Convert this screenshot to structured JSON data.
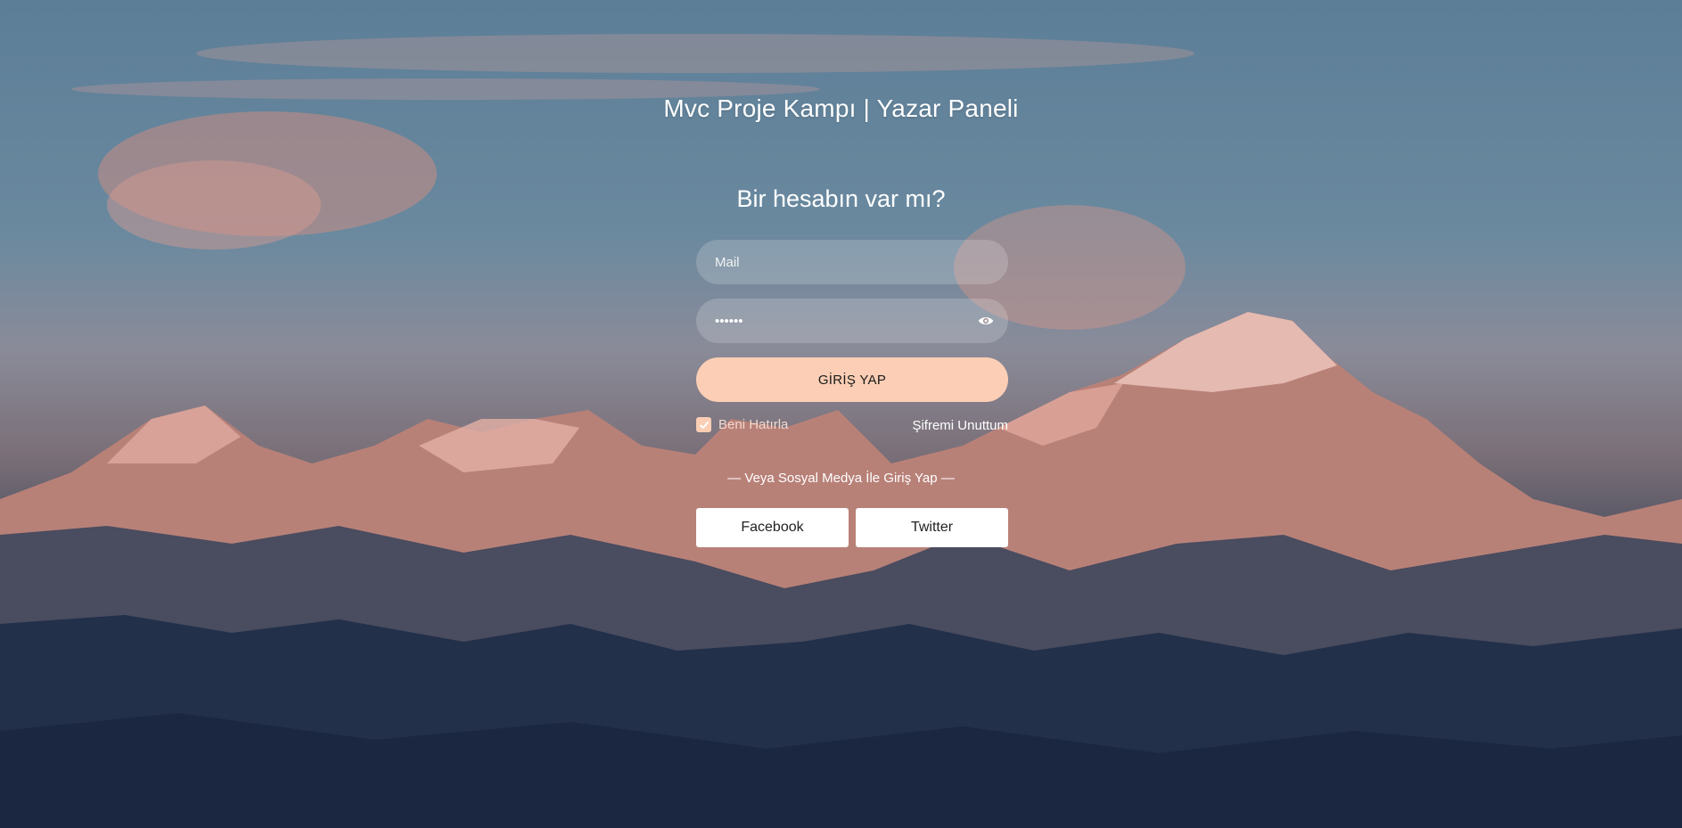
{
  "page": {
    "title": "Mvc Proje Kampı | Yazar Paneli",
    "subtitle": "Bir hesabın var mı?"
  },
  "form": {
    "mail_placeholder": "Mail",
    "password_value": "******",
    "password_toggle_icon": "eye-icon",
    "login_label": "GİRİŞ YAP",
    "remember_label": "Beni Hatırla",
    "remember_checked": true,
    "forgot_label": "Şifremi Unuttum"
  },
  "social": {
    "divider_text": "— Veya Sosyal Medya İle Giriş Yap —",
    "facebook_label": "Facebook",
    "twitter_label": "Twitter"
  },
  "colors": {
    "accent": "#fbceb5",
    "text": "#ffffff",
    "button_text": "#1a1a1a"
  }
}
